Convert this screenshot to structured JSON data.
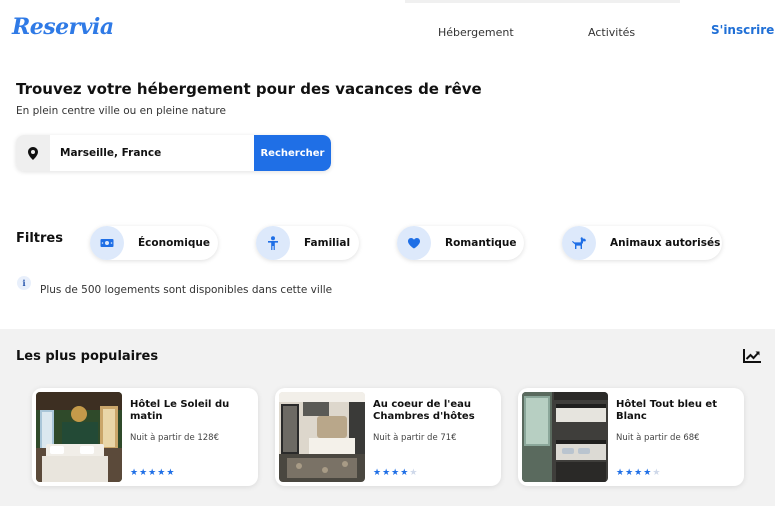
{
  "header": {
    "logo": "Reservia",
    "nav": [
      "Hébergement",
      "Activités"
    ],
    "signup": "S'inscrire"
  },
  "hero": {
    "title": "Trouvez votre hébergement pour des vacances de rêve",
    "subtitle": "En plein centre ville ou en pleine nature"
  },
  "search": {
    "icon": "location-pin-icon",
    "value": "Marseille, France",
    "button": "Rechercher"
  },
  "filters": {
    "label": "Filtres",
    "items": [
      {
        "label": "Économique",
        "icon": "money-icon"
      },
      {
        "label": "Familial",
        "icon": "child-icon"
      },
      {
        "label": "Romantique",
        "icon": "heart-icon"
      },
      {
        "label": "Animaux autorisés",
        "icon": "dog-icon"
      }
    ]
  },
  "info": {
    "icon": "info-icon",
    "text": "Plus de 500 logements sont disponibles dans cette ville"
  },
  "popular": {
    "title": "Les plus populaires",
    "icon": "trending-up-icon",
    "cards": [
      {
        "title": "Hôtel Le Soleil du matin",
        "price": "Nuit à partir de 128€",
        "rating": 5
      },
      {
        "title": "Au coeur de l'eau Chambres d'hôtes",
        "price": "Nuit à partir de 71€",
        "rating": 4
      },
      {
        "title": "Hôtel Tout bleu et Blanc",
        "price": "Nuit à partir de 68€",
        "rating": 4
      }
    ]
  },
  "colors": {
    "accent": "#1f6fe6",
    "logo": "#2f7ae6",
    "chip_icon_bg": "#dde9fb",
    "section_bg": "#f2f2f2"
  }
}
